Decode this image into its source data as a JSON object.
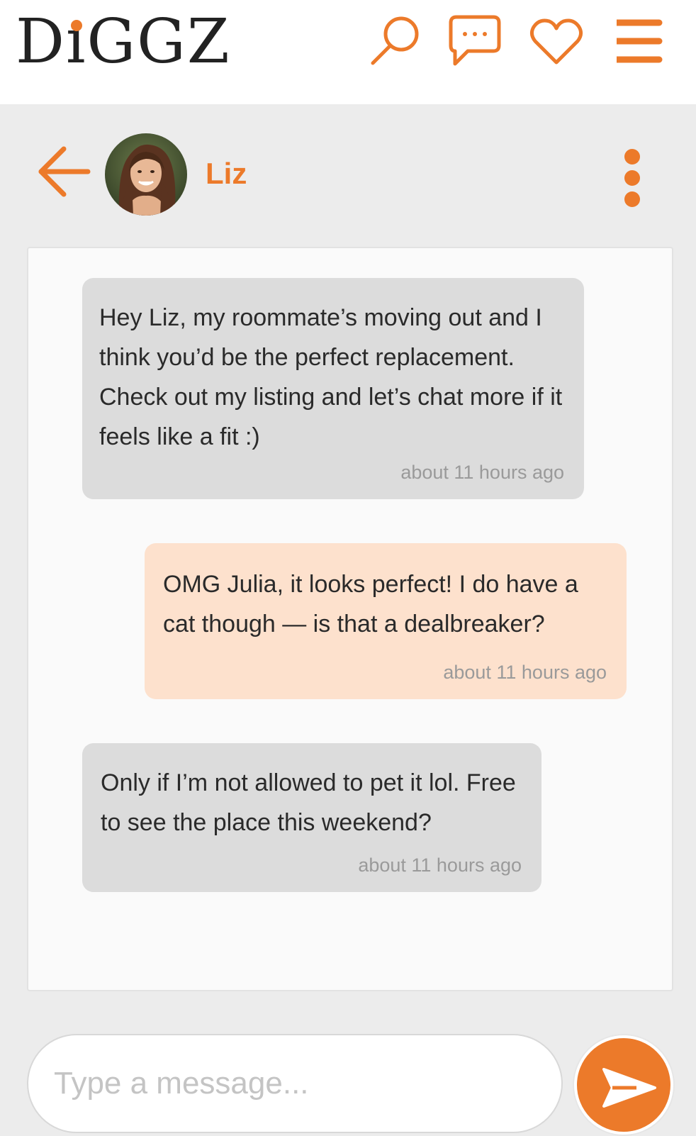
{
  "app": {
    "logo_text": "DiGGZ",
    "brand_color": "#ec7a2a"
  },
  "topbar": {
    "icons": [
      "search-icon",
      "chat-icon",
      "heart-icon",
      "menu-icon"
    ]
  },
  "conversation": {
    "contact_name": "Liz",
    "messages": [
      {
        "direction": "incoming",
        "text": "Hey Liz, my roommate’s moving out and I think you’d be the perfect replacement. Check out my listing and let’s chat more if it feels like a fit :)",
        "time": "about 11 hours ago"
      },
      {
        "direction": "outgoing",
        "text": "OMG Julia, it looks perfect! I do have a cat though — is that a dealbreaker?",
        "time": "about 11 hours ago"
      },
      {
        "direction": "incoming",
        "text": "Only if I’m not allowed to pet it lol. Free to see the place this weekend?",
        "time": "about 11 hours ago"
      }
    ]
  },
  "composer": {
    "placeholder": "Type a message...",
    "value": ""
  }
}
